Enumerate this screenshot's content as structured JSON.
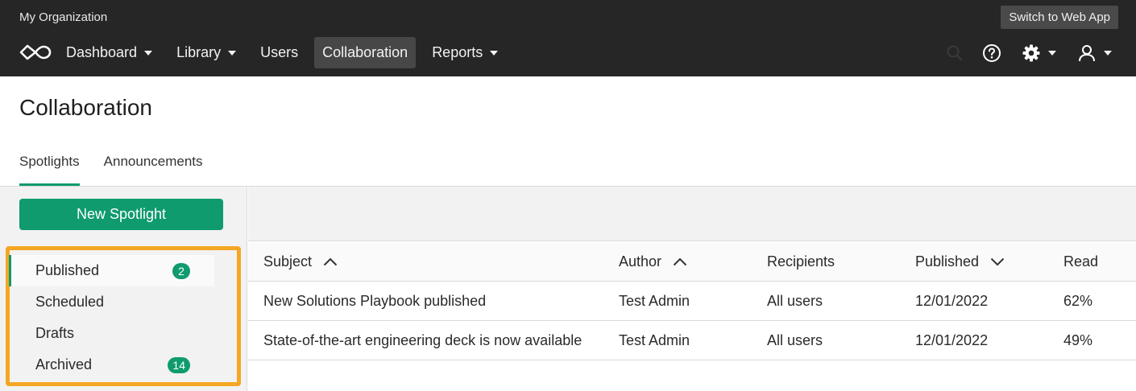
{
  "org_name": "My Organization",
  "switch_label": "Switch to Web App",
  "nav": {
    "items": [
      {
        "label": "Dashboard",
        "dropdown": true
      },
      {
        "label": "Library",
        "dropdown": true
      },
      {
        "label": "Users",
        "dropdown": false
      },
      {
        "label": "Collaboration",
        "dropdown": false,
        "active": true
      },
      {
        "label": "Reports",
        "dropdown": true
      }
    ]
  },
  "icons": {
    "logo": "infinity-logo-icon",
    "search": "search-icon",
    "help": "help-icon",
    "settings": "gear-icon",
    "user": "user-icon"
  },
  "page": {
    "title": "Collaboration",
    "tabs": [
      {
        "label": "Spotlights",
        "active": true
      },
      {
        "label": "Announcements",
        "active": false
      }
    ]
  },
  "left": {
    "new_button": "New Spotlight",
    "filters": [
      {
        "label": "Published",
        "count": "2",
        "active": true
      },
      {
        "label": "Scheduled",
        "count": null
      },
      {
        "label": "Drafts",
        "count": null
      },
      {
        "label": "Archived",
        "count": "14"
      }
    ]
  },
  "table": {
    "columns": [
      "Subject",
      "Author",
      "Recipients",
      "Published",
      "Read"
    ],
    "rows": [
      {
        "subject": "New Solutions Playbook published",
        "author": "Test Admin",
        "recipients": "All users",
        "published": "12/01/2022",
        "read": "62%"
      },
      {
        "subject": "State-of-the-art engineering deck is now available",
        "author": "Test Admin",
        "recipients": "All users",
        "published": "12/01/2022",
        "read": "49%"
      }
    ]
  },
  "colors": {
    "accent": "#0f9b6e",
    "topbar": "#262626",
    "highlight": "#f5a623"
  }
}
